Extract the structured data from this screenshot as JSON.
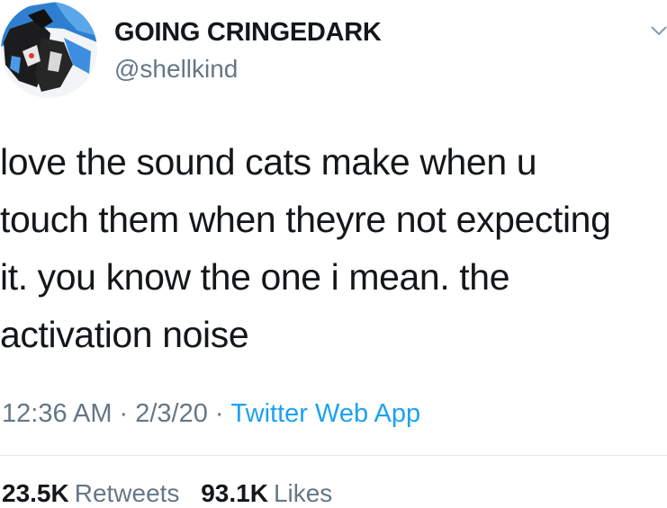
{
  "user": {
    "display_name": "GOING CRINGEDARK",
    "handle": "@shellkind"
  },
  "tweet": {
    "lines": [
      "love the sound cats make when u",
      "touch them when theyre not expecting",
      "it. you know the one i mean. the",
      "activation noise"
    ],
    "time": "12:36 AM",
    "separator": "·",
    "date": "2/3/20",
    "source": "Twitter Web App"
  },
  "stats": {
    "retweets_count": "23.5K",
    "retweets_label": "Retweets",
    "likes_count": "93.1K",
    "likes_label": "Likes"
  },
  "icons": {
    "avatar": "avatar-image",
    "menu": "chevron-down-icon"
  },
  "colors": {
    "text": "#14171a",
    "secondary": "#657786",
    "link": "#1da1f2",
    "divider": "#e1e8ed"
  }
}
